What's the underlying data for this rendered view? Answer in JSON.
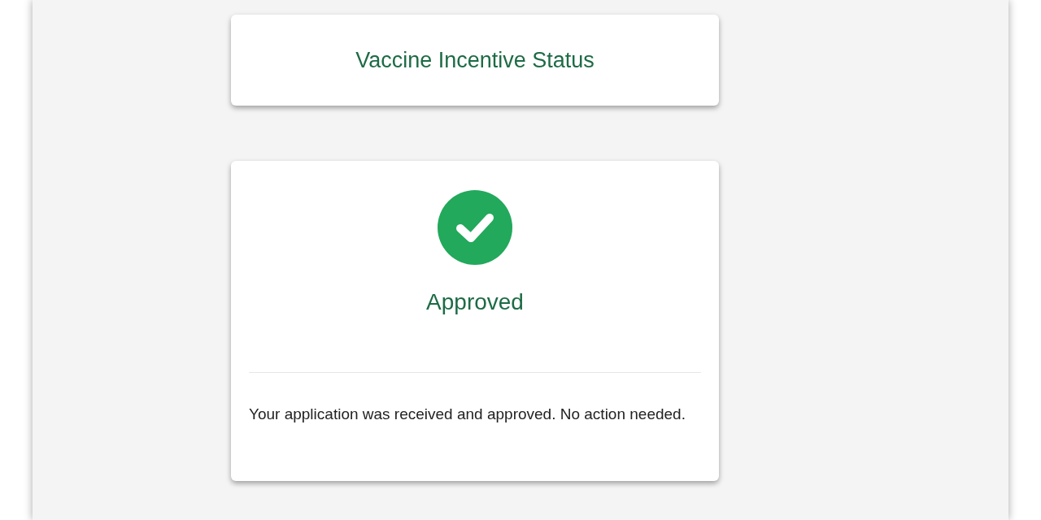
{
  "header": {
    "title": "Vaccine Incentive Status"
  },
  "status": {
    "kind": "approved",
    "label": "Approved",
    "message": "Your application was received and approved. No action needed."
  }
}
